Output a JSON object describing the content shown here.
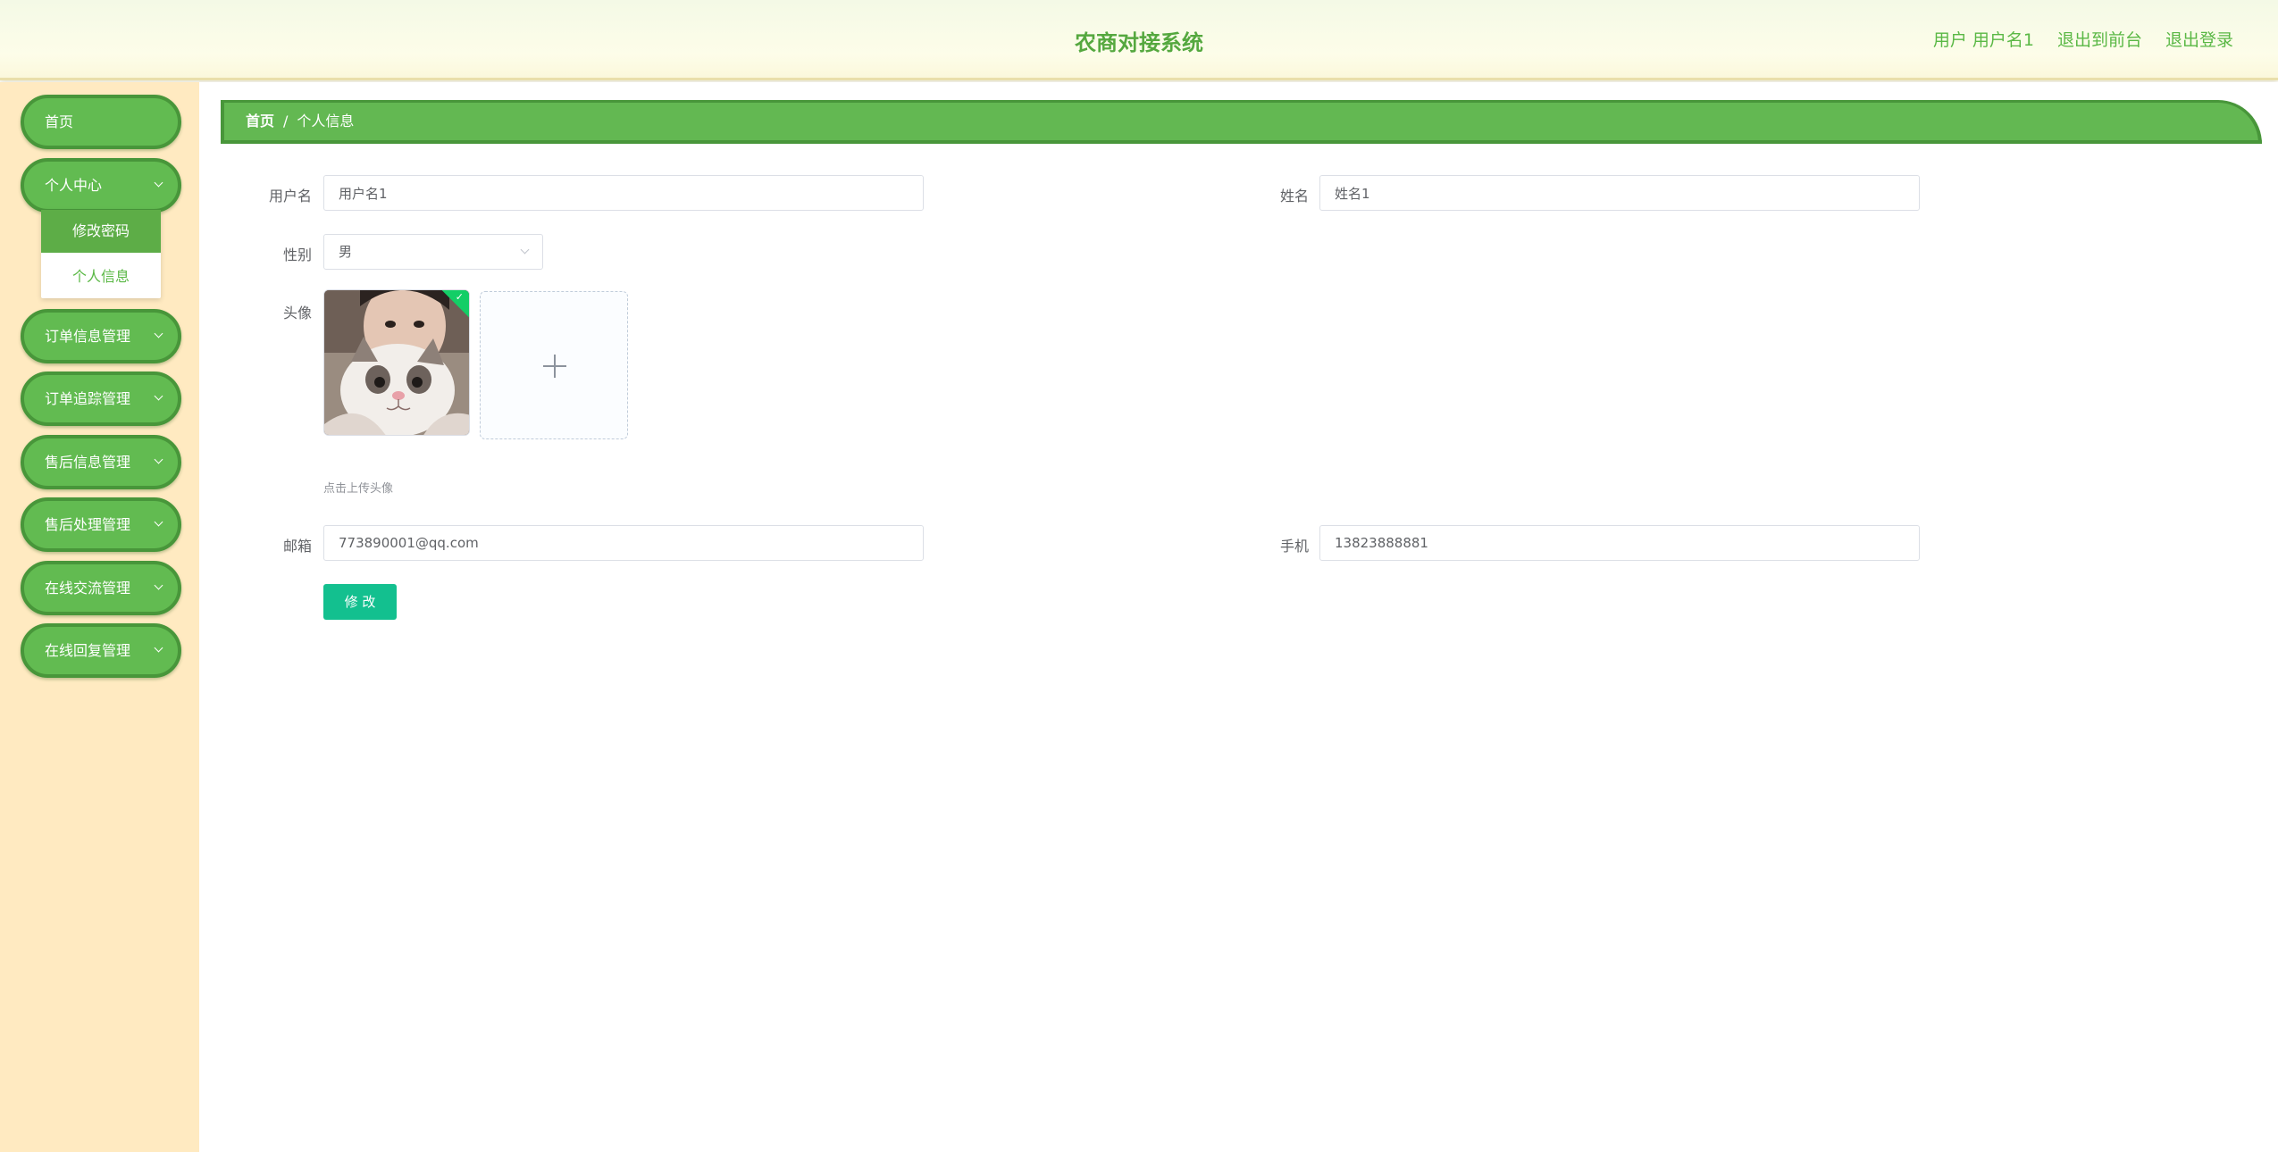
{
  "header": {
    "title": "农商对接系统",
    "user_label": "用户 用户名1",
    "front_link": "退出到前台",
    "logout_link": "退出登录"
  },
  "sidebar": {
    "items": [
      {
        "label": "首页",
        "expandable": false
      },
      {
        "label": "个人中心",
        "expandable": true
      },
      {
        "label": "订单信息管理",
        "expandable": true
      },
      {
        "label": "订单追踪管理",
        "expandable": true
      },
      {
        "label": "售后信息管理",
        "expandable": true
      },
      {
        "label": "售后处理管理",
        "expandable": true
      },
      {
        "label": "在线交流管理",
        "expandable": true
      },
      {
        "label": "在线回复管理",
        "expandable": true
      }
    ],
    "submenu": [
      {
        "label": "修改密码",
        "active": true
      },
      {
        "label": "个人信息",
        "active": false
      }
    ]
  },
  "breadcrumb": {
    "home": "首页",
    "separator": "/",
    "current": "个人信息"
  },
  "form": {
    "username": {
      "label": "用户名",
      "value": "用户名1"
    },
    "name": {
      "label": "姓名",
      "value": "姓名1"
    },
    "gender": {
      "label": "性别",
      "value": "男"
    },
    "avatar": {
      "label": "头像",
      "hint": "点击上传头像"
    },
    "email": {
      "label": "邮箱",
      "value": "773890001@qq.com"
    },
    "phone": {
      "label": "手机",
      "value": "13823888881"
    },
    "submit_label": "修 改"
  },
  "colors": {
    "accent_green": "#62bb51",
    "accent_green_border": "#48963a",
    "sidebar_bg": "#ffeac1",
    "header_text": "#55a83f",
    "submit_button": "#13c08f",
    "upload_success_badge": "#13ce66"
  },
  "icons": [
    "chevron-down-icon",
    "check-icon",
    "plus-icon"
  ]
}
